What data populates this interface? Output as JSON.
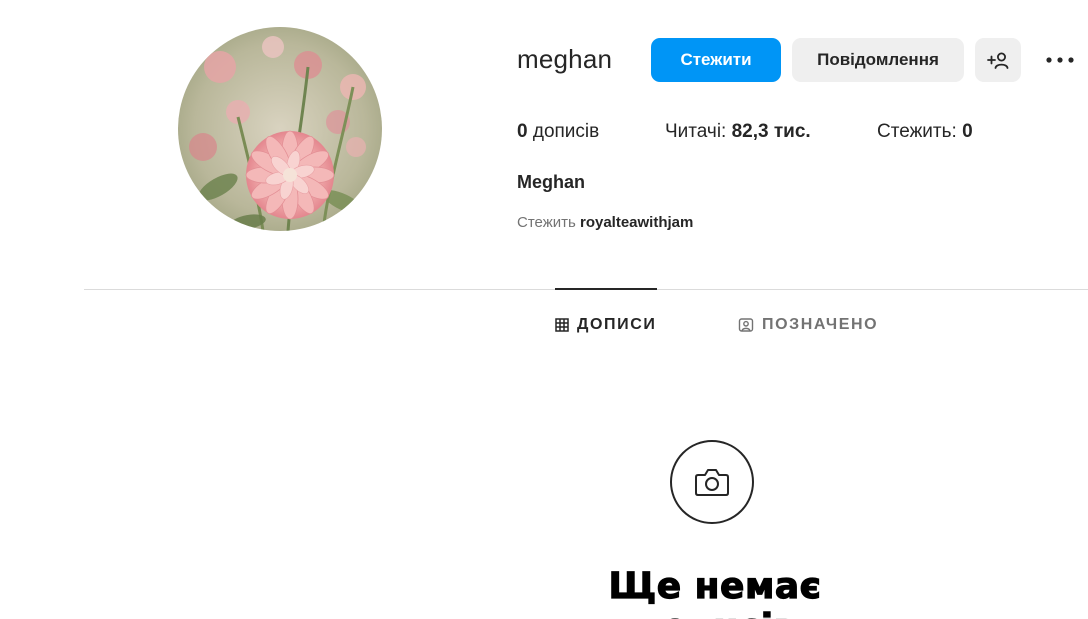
{
  "profile": {
    "username": "meghan",
    "full_name": "Meghan",
    "avatar_icon": "dahlia-flower-photo"
  },
  "actions": {
    "follow_label": "Стежити",
    "message_label": "Повідомлення",
    "suggest_icon": "add-person-icon",
    "more_icon": "more-horizontal-icon"
  },
  "stats": {
    "posts_count": "0",
    "posts_label": "дописів",
    "followers_label": "Читачі:",
    "followers_count": "82,3 тис.",
    "following_label": "Стежить:",
    "following_count": "0"
  },
  "followed_by": {
    "prefix": "Стежить",
    "name": "royalteawithjam"
  },
  "tabs": [
    {
      "label": "ДОПИСИ",
      "icon": "grid-icon",
      "active": true
    },
    {
      "label": "ПОЗНАЧЕНО",
      "icon": "tagged-icon",
      "active": false
    }
  ],
  "empty_state": {
    "icon": "camera-icon",
    "title": "Ще немає дописів"
  },
  "colors": {
    "primary": "#0095f6",
    "secondary_bg": "#efefef",
    "text": "#262626",
    "muted": "#737373",
    "divider": "#dbdbdb"
  }
}
